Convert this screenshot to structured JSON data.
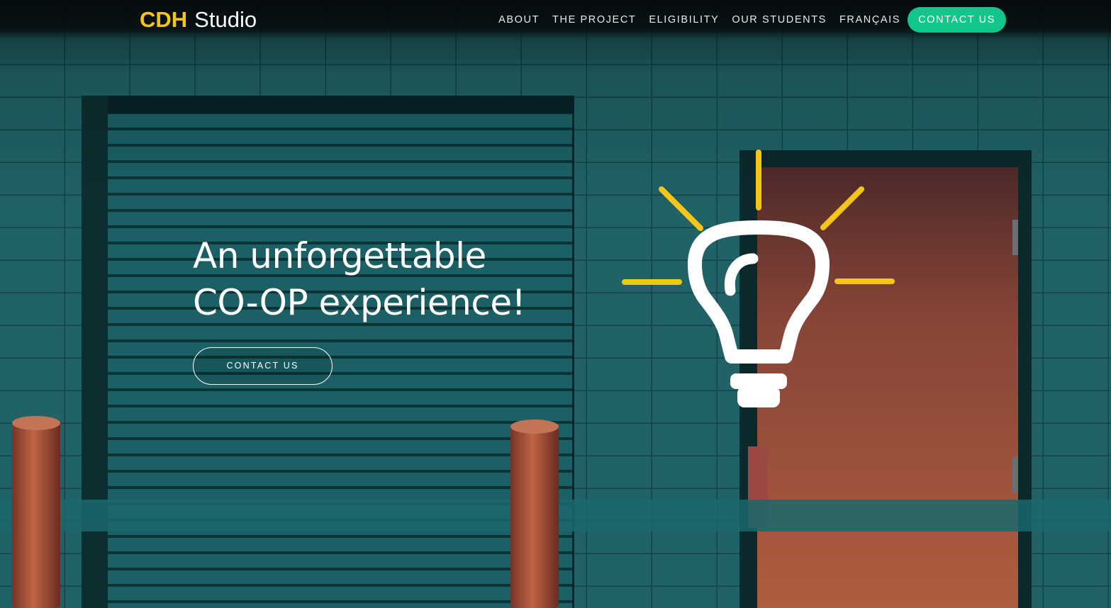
{
  "brand": {
    "strong": "CDH",
    "light": "Studio"
  },
  "nav": {
    "links": [
      {
        "label": "ABOUT"
      },
      {
        "label": "THE PROJECT"
      },
      {
        "label": "ELIGIBILITY"
      },
      {
        "label": "OUR STUDENTS"
      },
      {
        "label": "FRANÇAIS"
      }
    ],
    "cta_label": "CONTACT US"
  },
  "hero": {
    "headline": "An unforgettable CO-OP experience!",
    "cta_label": "CONTACT US",
    "icon": "lightbulb-icon"
  },
  "colors": {
    "brand_yellow": "#f5c518",
    "cta_green": "#12c58b",
    "wall_teal": "#2a7f84",
    "door_orange": "#c86a48"
  }
}
